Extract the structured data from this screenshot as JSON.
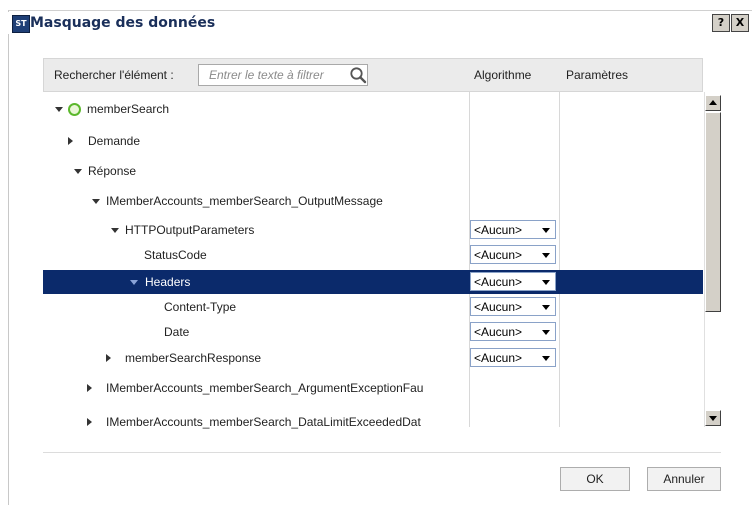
{
  "window": {
    "title": "Masquage des données",
    "icon_text": "ST",
    "help_label": "?",
    "close_label": "X"
  },
  "search": {
    "label": "Rechercher l'élément :",
    "placeholder": "Entrer le texte à filtrer"
  },
  "columns": {
    "algorithm": "Algorithme",
    "parameters": "Paramètres"
  },
  "tree": {
    "rows": [
      {
        "label": "memberSearch",
        "expander": "down",
        "status": "green"
      },
      {
        "label": "Demande",
        "expander": "right"
      },
      {
        "label": "Réponse",
        "expander": "down"
      },
      {
        "label": "IMemberAccounts_memberSearch_OutputMessage",
        "expander": "down"
      },
      {
        "label": "HTTPOutputParameters",
        "expander": "down",
        "algorithm": "<Aucun>"
      },
      {
        "label": "StatusCode",
        "algorithm": "<Aucun>"
      },
      {
        "label": "Headers",
        "expander": "down",
        "algorithm": "<Aucun>",
        "selected": true
      },
      {
        "label": "Content-Type",
        "algorithm": "<Aucun>"
      },
      {
        "label": "Date",
        "algorithm": "<Aucun>"
      },
      {
        "label": "memberSearchResponse",
        "expander": "right",
        "algorithm": "<Aucun>"
      },
      {
        "label": "IMemberAccounts_memberSearch_ArgumentExceptionFau",
        "expander": "right"
      },
      {
        "label": "IMemberAccounts_memberSearch_DataLimitExceededDat",
        "expander": "right"
      }
    ]
  },
  "buttons": {
    "ok": "OK",
    "cancel": "Annuler"
  },
  "colors": {
    "selection": "#0b2a6b",
    "status_ok": "#5cb82d"
  },
  "icons": {
    "search": "search-icon",
    "expand": "chevron-down-icon",
    "collapse": "chevron-right-icon"
  }
}
